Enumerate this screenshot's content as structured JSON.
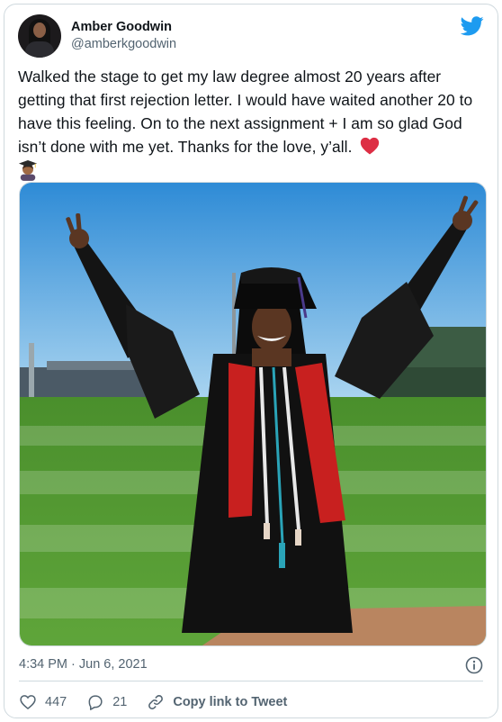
{
  "author": {
    "display_name": "Amber Goodwin",
    "handle": "@amberkgoodwin"
  },
  "tweet": {
    "text": "Walked the stage to get my law degree almost 20 years after getting that first rejection letter. I would have waited another 20 to have this feeling. On to the next assignment + I am so glad God isn’t done with me yet. Thanks for the love, y’all.",
    "emojis": [
      "red-heart-icon",
      "graduate-icon"
    ]
  },
  "media": {
    "kind": "photo"
  },
  "meta": {
    "timestamp": "4:34 PM · Jun 6, 2021"
  },
  "actions": {
    "likes": "447",
    "replies": "21",
    "copy_link_label": "Copy link to Tweet"
  },
  "colors": {
    "twitter_blue": "#1d9bf0",
    "text_primary": "#0f1419",
    "text_secondary": "#536471",
    "border": "#cfd9de",
    "heart_red": "#e0245e"
  }
}
